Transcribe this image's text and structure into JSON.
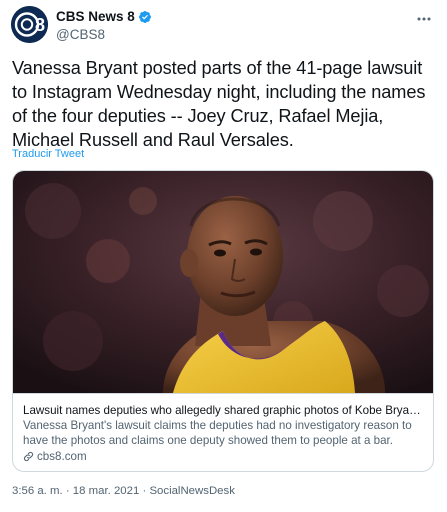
{
  "author": {
    "avatar_text": "8",
    "name": "CBS News 8",
    "handle": "@CBS8"
  },
  "tweet": {
    "text": "Vanessa Bryant posted parts of the 41-page lawsuit to Instagram Wednesday night, including the names of the four deputies -- Joey Cruz, Rafael Mejia, Michael Russell and Raul Versales.",
    "translate_label": "Traducir Tweet"
  },
  "card": {
    "title": "Lawsuit names deputies who allegedly shared graphic photos of Kobe Bryant crash",
    "description": "Vanessa Bryant's lawsuit claims the deputies had no investigatory reason to have the photos and claims one deputy showed them to people at a bar.",
    "domain": "cbs8.com"
  },
  "footer": {
    "time": "3:56 a. m.",
    "separator": "·",
    "date": "18 mar. 2021",
    "source": "SocialNewsDesk"
  },
  "colors": {
    "accent": "#1d9bf0",
    "secondary_text": "#536471",
    "border": "#cfd9de",
    "avatar_bg": "#0e2a52",
    "jersey": "#f2c12e"
  },
  "icons": [
    "cbs8-logo-icon",
    "verified-badge-icon",
    "more-options-icon",
    "link-icon"
  ]
}
